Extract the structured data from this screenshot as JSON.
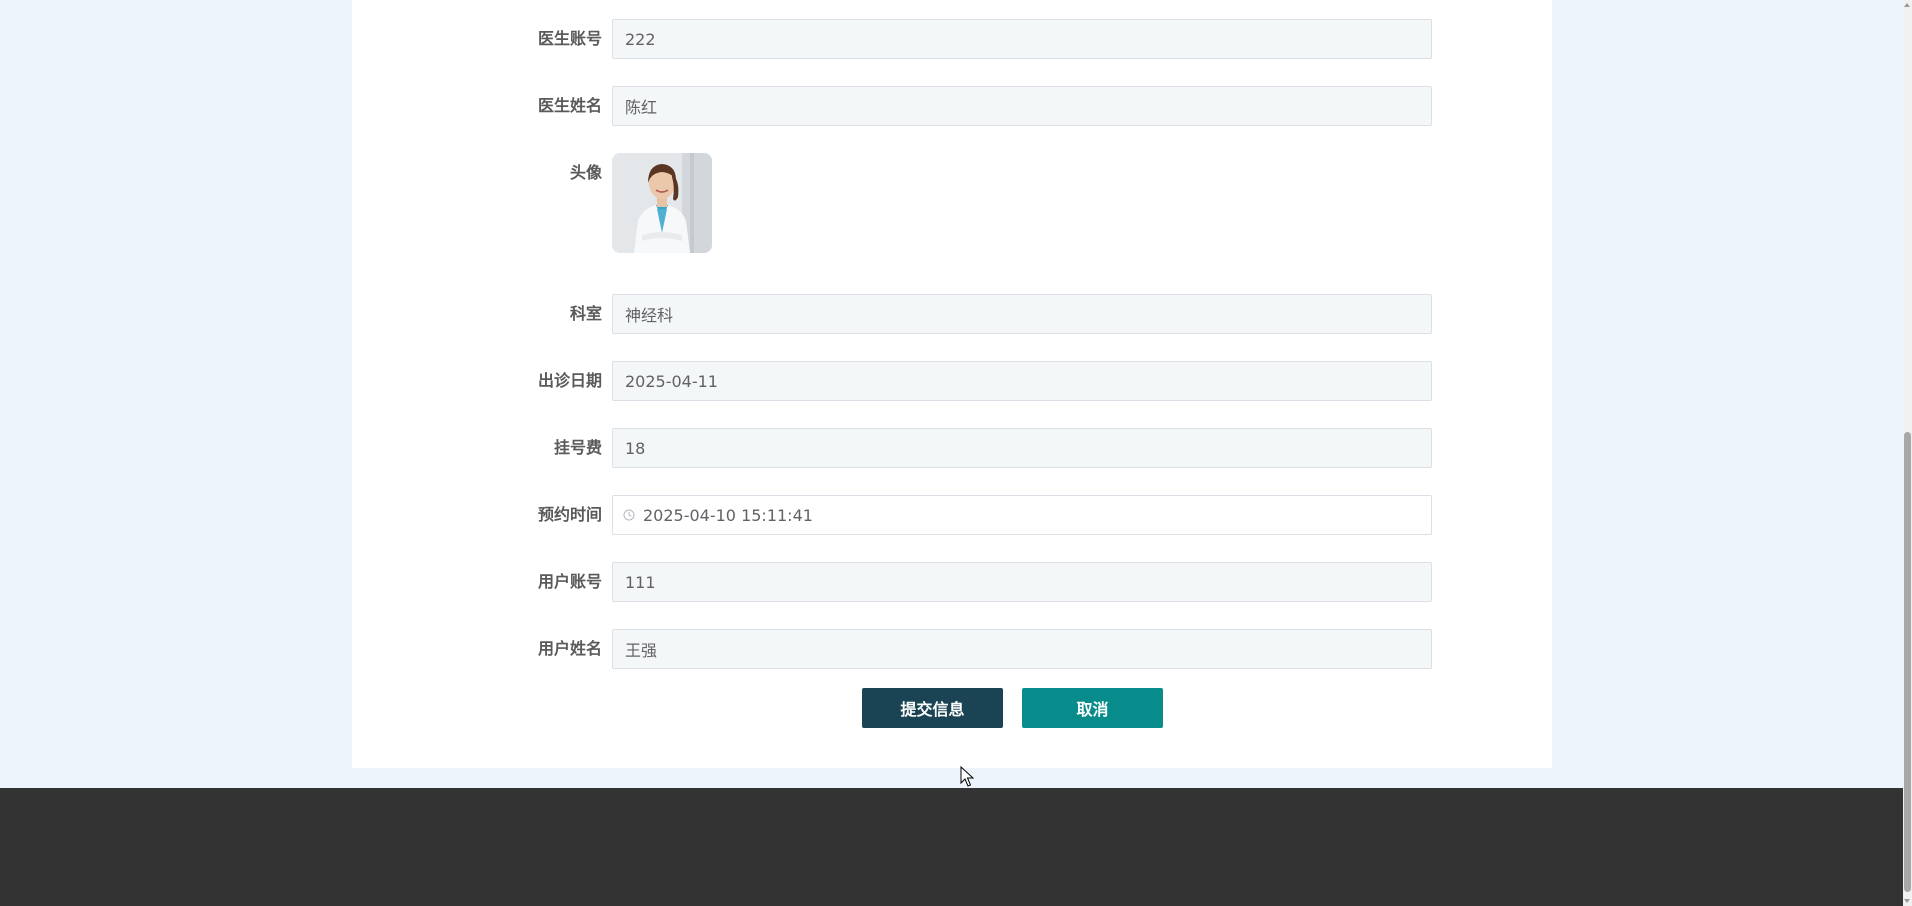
{
  "form": {
    "doctor_account": {
      "label": "医生账号",
      "value": "222"
    },
    "doctor_name": {
      "label": "医生姓名",
      "value": "陈红"
    },
    "avatar": {
      "label": "头像"
    },
    "department": {
      "label": "科室",
      "value": "神经科"
    },
    "visit_date": {
      "label": "出诊日期",
      "value": "2025-04-11"
    },
    "registration_fee": {
      "label": "挂号费",
      "value": "18"
    },
    "appointment_time": {
      "label": "预约时间",
      "value": "2025-04-10 15:11:41",
      "icon": "clock-icon"
    },
    "user_account": {
      "label": "用户账号",
      "value": "111"
    },
    "user_name": {
      "label": "用户姓名",
      "value": "王强"
    }
  },
  "buttons": {
    "submit_label": "提交信息",
    "cancel_label": "取消"
  },
  "colors": {
    "page_background": "#eef4fc",
    "submit_button": "#1a4453",
    "cancel_button": "#078b8b",
    "footer": "#333333"
  }
}
